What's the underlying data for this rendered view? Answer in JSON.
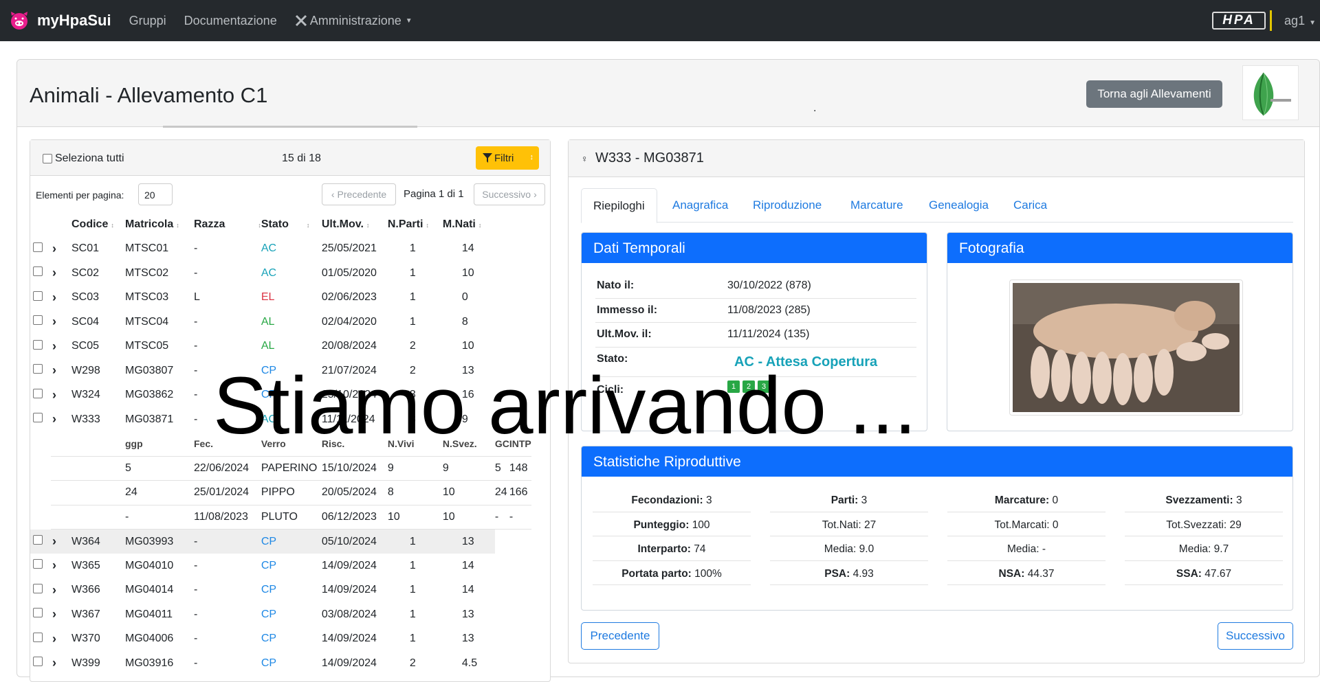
{
  "navbar": {
    "brand": "myHpaSui",
    "links": [
      "Gruppi",
      "Documentazione",
      "Amministrazione"
    ],
    "logo_text": "HPA",
    "user": "ag1"
  },
  "header": {
    "title": "Animali - Allevamento C1",
    "back_button": "Torna agli Allevamenti",
    "dot": "."
  },
  "list": {
    "select_all": "Seleziona tutti",
    "count": "15 di 18",
    "filters_button": "Filtri",
    "per_page_label": "Elementi per pagina:",
    "per_page_value": "20",
    "prev": "Precedente",
    "page_info": "Pagina 1 di 1",
    "next": "Successivo",
    "columns": [
      "Codice",
      "Matricola",
      "Razza",
      "Stato",
      "Ult.Mov.",
      "N.Parti",
      "M.Nati"
    ],
    "rows": [
      {
        "codice": "SC01",
        "matricola": "MTSC01",
        "razza": "-",
        "stato": "AC",
        "ultmov": "25/05/2021",
        "nparti": "1",
        "mnati": "14",
        "color": "#17a2b8"
      },
      {
        "codice": "SC02",
        "matricola": "MTSC02",
        "razza": "-",
        "stato": "AC",
        "ultmov": "01/05/2020",
        "nparti": "1",
        "mnati": "10",
        "color": "#17a2b8"
      },
      {
        "codice": "SC03",
        "matricola": "MTSC03",
        "razza": "L",
        "stato": "EL",
        "ultmov": "02/06/2023",
        "nparti": "1",
        "mnati": "0",
        "color": "#dc3545"
      },
      {
        "codice": "SC04",
        "matricola": "MTSC04",
        "razza": "-",
        "stato": "AL",
        "ultmov": "02/04/2020",
        "nparti": "1",
        "mnati": "8",
        "color": "#28a745"
      },
      {
        "codice": "SC05",
        "matricola": "MTSC05",
        "razza": "-",
        "stato": "AL",
        "ultmov": "20/08/2024",
        "nparti": "2",
        "mnati": "10",
        "color": "#28a745"
      },
      {
        "codice": "W298",
        "matricola": "MG03807",
        "razza": "-",
        "stato": "CP",
        "ultmov": "21/07/2024",
        "nparti": "2",
        "mnati": "13",
        "color": "#1e88e5"
      },
      {
        "codice": "W324",
        "matricola": "MG03862",
        "razza": "-",
        "stato": "CP",
        "ultmov": "25/10/2024",
        "nparti": "3",
        "mnati": "16",
        "color": "#1e88e5"
      },
      {
        "codice": "W333",
        "matricola": "MG03871",
        "razza": "-",
        "stato": "AC",
        "ultmov": "11/11/2024",
        "nparti": "3",
        "mnati": "9",
        "color": "#17a2b8"
      }
    ],
    "sub_columns": [
      "ggp",
      "Fec.",
      "Verro",
      "Risc.",
      "N.Vivi",
      "N.Svez.",
      "GC",
      "INTP"
    ],
    "sub_rows": [
      [
        "5",
        "22/06/2024",
        "PAPERINO",
        "15/10/2024",
        "9",
        "9",
        "5",
        "148"
      ],
      [
        "24",
        "25/01/2024",
        "PIPPO",
        "20/05/2024",
        "8",
        "10",
        "24",
        "166"
      ],
      [
        "-",
        "11/08/2023",
        "PLUTO",
        "06/12/2023",
        "10",
        "10",
        "-",
        "-"
      ]
    ],
    "rows_after": [
      {
        "codice": "W364",
        "matricola": "MG03993",
        "razza": "-",
        "stato": "CP",
        "ultmov": "05/10/2024",
        "nparti": "1",
        "mnati": "13",
        "color": "#1e88e5"
      },
      {
        "codice": "W365",
        "matricola": "MG04010",
        "razza": "-",
        "stato": "CP",
        "ultmov": "14/09/2024",
        "nparti": "1",
        "mnati": "14",
        "color": "#1e88e5"
      },
      {
        "codice": "W366",
        "matricola": "MG04014",
        "razza": "-",
        "stato": "CP",
        "ultmov": "14/09/2024",
        "nparti": "1",
        "mnati": "14",
        "color": "#1e88e5"
      },
      {
        "codice": "W367",
        "matricola": "MG04011",
        "razza": "-",
        "stato": "CP",
        "ultmov": "03/08/2024",
        "nparti": "1",
        "mnati": "13",
        "color": "#1e88e5"
      },
      {
        "codice": "W370",
        "matricola": "MG04006",
        "razza": "-",
        "stato": "CP",
        "ultmov": "14/09/2024",
        "nparti": "1",
        "mnati": "13",
        "color": "#1e88e5"
      },
      {
        "codice": "W399",
        "matricola": "MG03916",
        "razza": "-",
        "stato": "CP",
        "ultmov": "14/09/2024",
        "nparti": "2",
        "mnati": "4.5",
        "color": "#1e88e5"
      }
    ]
  },
  "detail": {
    "sex_symbol": "♀",
    "title": "W333 - MG03871",
    "tabs": [
      "Riepiloghi",
      "Anagrafica",
      "Riproduzione",
      "Marcature",
      "Genealogia",
      "Carica"
    ],
    "temporal": {
      "title": "Dati Temporali",
      "rows": [
        {
          "k": "Nato il:",
          "v": "30/10/2022 (878)"
        },
        {
          "k": "Immesso il:",
          "v": "11/08/2023 (285)"
        },
        {
          "k": "Ult.Mov. il:",
          "v": "11/11/2024 (135)"
        }
      ],
      "stato_label": "Stato:",
      "stato_value": "AC - Attesa Copertura",
      "cicli_label": "Cicli:",
      "cicli": [
        "1",
        "2",
        "3"
      ]
    },
    "photo_title": "Fotografia",
    "stats": {
      "title": "Statistiche Riproduttive",
      "columns": [
        [
          {
            "k": "Fecondazioni:",
            "v": "3",
            "b": true
          },
          {
            "k": "Punteggio:",
            "v": "100",
            "b": true
          },
          {
            "k": "Interparto:",
            "v": "74",
            "b": true
          },
          {
            "k": "Portata parto:",
            "v": "100%",
            "b": true
          }
        ],
        [
          {
            "k": "Parti:",
            "v": "3",
            "b": true
          },
          {
            "k": "Tot.Nati:",
            "v": "27",
            "b": false
          },
          {
            "k": "Media:",
            "v": "9.0",
            "b": false
          },
          {
            "k": "PSA:",
            "v": "4.93",
            "b": true
          }
        ],
        [
          {
            "k": "Marcature:",
            "v": "0",
            "b": true
          },
          {
            "k": "Tot.Marcati:",
            "v": "0",
            "b": false
          },
          {
            "k": "Media:",
            "v": "-",
            "b": false
          },
          {
            "k": "NSA:",
            "v": "44.37",
            "b": true
          }
        ],
        [
          {
            "k": "Svezzamenti:",
            "v": "3",
            "b": true
          },
          {
            "k": "Tot.Svezzati:",
            "v": "29",
            "b": false
          },
          {
            "k": "Media:",
            "v": "9.7",
            "b": false
          },
          {
            "k": "SSA:",
            "v": "47.67",
            "b": true
          }
        ]
      ]
    },
    "prev_button": "Precedente",
    "next_button": "Successivo"
  },
  "overlay_text": "Stiamo arrivando ..."
}
